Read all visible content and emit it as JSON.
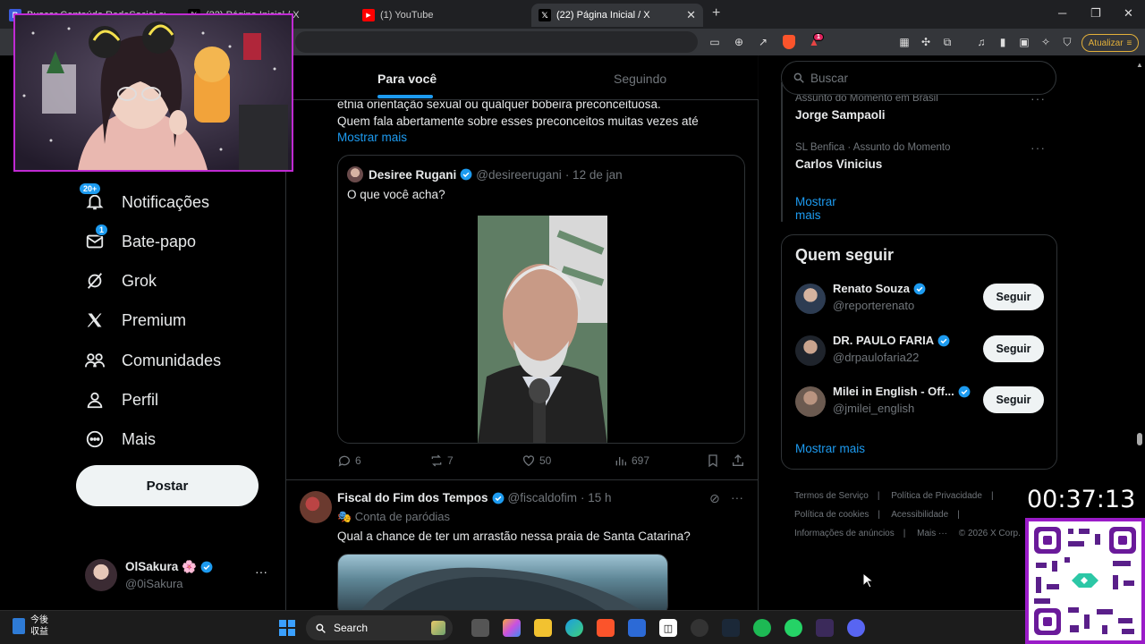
{
  "browser": {
    "tabs": [
      {
        "label": "Buscar Conteúdo RedeSocial avanç..."
      },
      {
        "label": "(22) Página Inicial / X"
      },
      {
        "label": "(1) YouTube"
      },
      {
        "label": "(22) Página Inicial / X"
      }
    ],
    "update_button": "Atualizar",
    "notification_count": "1"
  },
  "nav": {
    "items": [
      {
        "label": "Notificações",
        "icon": "bell-icon",
        "badge": "20+"
      },
      {
        "label": "Bate-papo",
        "icon": "mail-icon",
        "badge": "1"
      },
      {
        "label": "Grok",
        "icon": "grok-icon"
      },
      {
        "label": "Premium",
        "icon": "x-logo-icon"
      },
      {
        "label": "Comunidades",
        "icon": "people-icon"
      },
      {
        "label": "Perfil",
        "icon": "person-icon"
      },
      {
        "label": "Mais",
        "icon": "more-circle-icon"
      }
    ],
    "post_button": "Postar",
    "account": {
      "name": "OlSakura 🌸",
      "handle": "@0iSakura"
    }
  },
  "feed": {
    "tabs": [
      "Para você",
      "Seguindo"
    ],
    "tweet1": {
      "lines": [
        "etnia orientação sexual ou qualquer bobeira preconceituosa.",
        "Quem fala abertamente sobre esses preconceitos muitas vezes até"
      ],
      "show_more": "Mostrar mais",
      "quote": {
        "name": "Desiree Rugani",
        "handle": "@desireerugani",
        "time": "· 12 de jan",
        "text": "O que você acha?"
      },
      "stats": {
        "replies": "6",
        "reposts": "7",
        "likes": "50",
        "views": "697"
      }
    },
    "tweet2": {
      "name": "Fiscal do Fim dos Tempos",
      "handle": "@fiscaldofim",
      "time": "· 15 h",
      "label": "🎭 Conta de paródias",
      "text": "Qual a chance de ter um arrastão nessa praia de Santa Catarina?"
    }
  },
  "sidebar": {
    "search_placeholder": "Buscar",
    "trends": [
      {
        "meta": "Assunto do Momento em Brasil",
        "name": "Jorge Sampaoli"
      },
      {
        "meta": "SL Benfica · Assunto do Momento",
        "name": "Carlos Vinicius"
      }
    ],
    "trends_more": "Mostrar mais",
    "who_to_follow": {
      "title": "Quem seguir",
      "people": [
        {
          "name": "Renato Souza",
          "handle": "@reporterenato",
          "button": "Seguir"
        },
        {
          "name": "DR. PAULO FARIA",
          "handle": "@drpaulofaria22",
          "button": "Seguir"
        },
        {
          "name": "Milei in English - Off...",
          "handle": "@jmilei_english",
          "button": "Seguir"
        }
      ],
      "more": "Mostrar mais"
    },
    "footer": [
      "Termos de Serviço",
      "|",
      "Política de Privacidade",
      "|",
      "Política de cookies",
      "|",
      "Acessibilidade",
      "|",
      "Informações de anúncios",
      "|",
      "Mais ···",
      "© 2026 X Corp."
    ]
  },
  "overlay": {
    "timer": "00:37:13"
  },
  "taskbar": {
    "weather_line1": "今後",
    "weather_line2": "収益",
    "search": "Search"
  }
}
